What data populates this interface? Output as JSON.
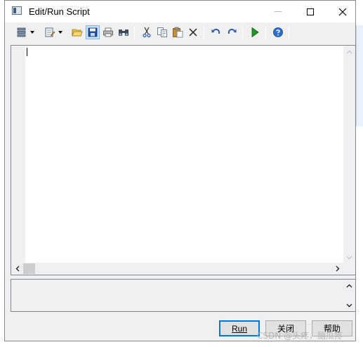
{
  "window": {
    "title": "Edit/Run Script"
  },
  "toolbar": {
    "items": [
      {
        "name": "view-menu-icon"
      },
      {
        "name": "edit-menu-icon"
      },
      {
        "name": "open-folder-icon"
      },
      {
        "name": "save-icon"
      },
      {
        "name": "print-icon"
      },
      {
        "name": "find-icon"
      },
      {
        "name": "cut-icon"
      },
      {
        "name": "copy-icon"
      },
      {
        "name": "paste-icon"
      },
      {
        "name": "delete-icon"
      },
      {
        "name": "undo-icon"
      },
      {
        "name": "redo-icon"
      },
      {
        "name": "run-icon"
      },
      {
        "name": "help-icon"
      }
    ]
  },
  "editor": {
    "content": ""
  },
  "output": {
    "content": ""
  },
  "buttons": {
    "run": "Run",
    "close": "关闭",
    "help": "帮助"
  },
  "watermark": "CSDN @头疼，脑瓜疼",
  "colors": {
    "accent": "#0078d7",
    "run_green": "#1b9e1b",
    "undo_blue": "#2a5db0",
    "help_blue": "#2a6fd1"
  }
}
